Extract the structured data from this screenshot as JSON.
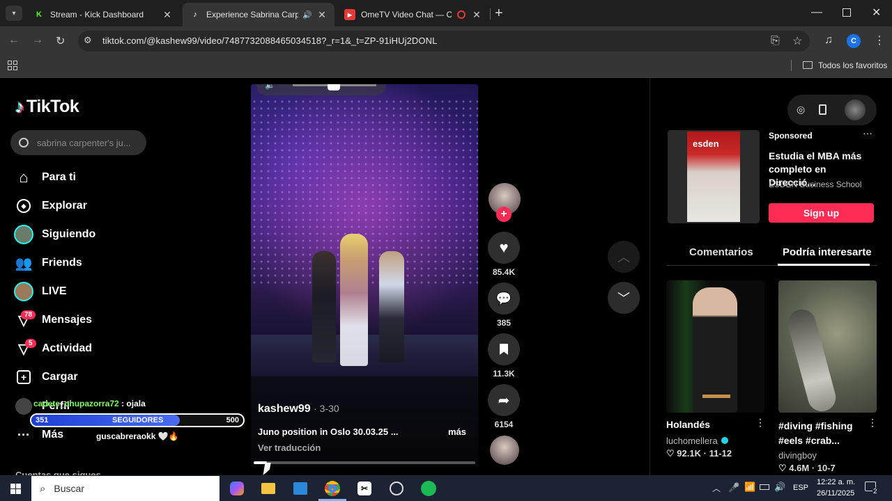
{
  "browser": {
    "tabs": [
      {
        "title": "Stream - Kick Dashboard",
        "favicon": "K"
      },
      {
        "title": "Experience Sabrina Carpenter",
        "favicon": "♪"
      },
      {
        "title": "OmeTV Video Chat — Ome",
        "favicon": "▶"
      }
    ],
    "url": "tiktok.com/@kashew99/video/7487732088465034518?_r=1&_t=ZP-91iHUj2DONL",
    "bookmarks_label": "Todos los favoritos",
    "profile_letter": "C"
  },
  "tiktok": {
    "logo": "TikTok",
    "search_placeholder": "sabrina carpenter's ju...",
    "nav": [
      {
        "label": "Para ti"
      },
      {
        "label": "Explorar"
      },
      {
        "label": "Siguiendo"
      },
      {
        "label": "Friends"
      },
      {
        "label": "LIVE"
      },
      {
        "label": "Mensajes",
        "badge": "78"
      },
      {
        "label": "Actividad",
        "badge": "5"
      },
      {
        "label": "Cargar"
      },
      {
        "label": "Perfil"
      },
      {
        "label": "Más"
      }
    ],
    "following_header": "Cuentas que sigues",
    "video": {
      "author": "kashew99",
      "date": "· 3-30",
      "caption": "Juno position in Oslo 30.03.25 ...",
      "more": "más",
      "translate": "Ver traducción"
    },
    "actions": {
      "likes": "85.4K",
      "comments": "385",
      "saves": "11.3K",
      "shares": "6154"
    },
    "ad": {
      "sponsored": "Sponsored",
      "title": "Estudia el MBA más completo en Direcció...",
      "advertiser": "ESDEN Business School",
      "cta": "Sign up",
      "thumb_logo": "esden"
    },
    "right_tabs": [
      "Comentarios",
      "Podría interesarte"
    ],
    "suggestions": [
      {
        "title": "Holandés",
        "author": "luchomellera",
        "likes": "92.1K",
        "date": "11-12"
      },
      {
        "title": "#diving #fishing #eels #crab...",
        "author": "divingboy",
        "likes": "4.6M",
        "date": "10-7"
      }
    ]
  },
  "overlay": {
    "chat1_user": "cadete_chupazorra72",
    "chat1_msg": ": ojala",
    "goal_current": "351",
    "goal_label": "SEGUIDORES",
    "goal_target": "500",
    "goal_progress": 0.702,
    "chat2_user": "guscabreraokk",
    "chat2_msg": "🤍🔥"
  },
  "taskbar": {
    "search_placeholder": "Buscar",
    "lang": "ESP",
    "time": "12:22 a. m.",
    "date": "26/11/2025",
    "notif_count": "2"
  },
  "colors": {
    "accent": "#fe2c55",
    "chrome": "#353535",
    "teal": "#25f4ee"
  }
}
